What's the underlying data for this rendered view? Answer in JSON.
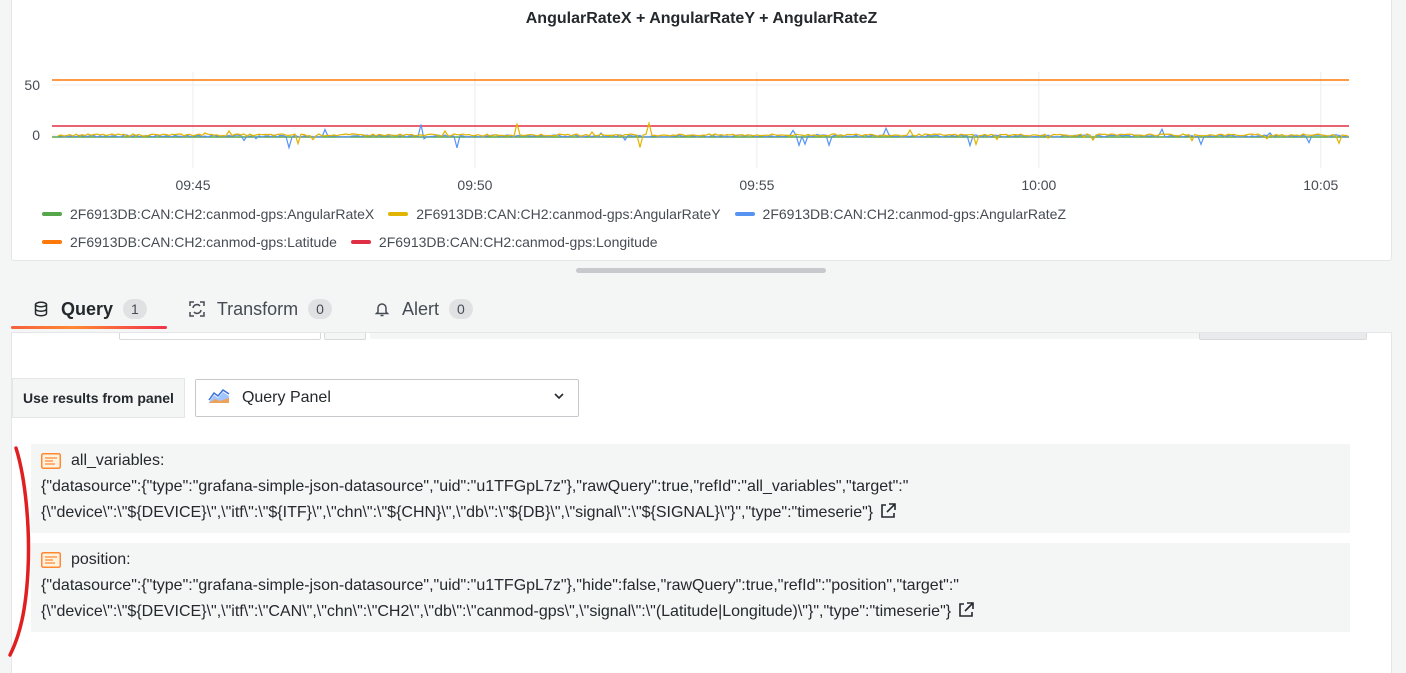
{
  "panel": {
    "title": "AngularRateX + AngularRateY + AngularRateZ"
  },
  "chart_data": {
    "type": "line",
    "title": "AngularRateX + AngularRateY + AngularRateZ",
    "y_ticks": [
      "50",
      "0"
    ],
    "y_tick_values": [
      50,
      0
    ],
    "x_ticks": [
      "09:45",
      "09:50",
      "09:55",
      "10:00",
      "10:05"
    ],
    "x_range": [
      "09:42:30",
      "10:05:30"
    ],
    "grid": true,
    "legend_position": "bottom",
    "series": [
      {
        "name": "2F6913DB:CAN:CH2:canmod-gps:AngularRateX",
        "color": "#56a64b",
        "approx_value": -2
      },
      {
        "name": "2F6913DB:CAN:CH2:canmod-gps:AngularRateY",
        "color": "#e0b400",
        "approx_value": 0,
        "noisy": true
      },
      {
        "name": "2F6913DB:CAN:CH2:canmod-gps:AngularRateZ",
        "color": "#5794f2",
        "approx_value": -1,
        "noisy": true
      },
      {
        "name": "2F6913DB:CAN:CH2:canmod-gps:Latitude",
        "color": "#ff780a",
        "approx_value": 55
      },
      {
        "name": "2F6913DB:CAN:CH2:canmod-gps:Longitude",
        "color": "#e02f44",
        "approx_value": 9
      }
    ]
  },
  "tabs": [
    {
      "label": "Query",
      "count": "1",
      "active": true,
      "icon": "database-icon"
    },
    {
      "label": "Transform",
      "count": "0",
      "active": false,
      "icon": "transform-icon"
    },
    {
      "label": "Alert",
      "count": "0",
      "active": false,
      "icon": "bell-icon"
    }
  ],
  "use_results": {
    "label": "Use results from panel",
    "selected": "Query Panel"
  },
  "queries": [
    {
      "name": "all_variables:",
      "line1": "{\"datasource\":{\"type\":\"grafana-simple-json-datasource\",\"uid\":\"u1TFGpL7z\"},\"rawQuery\":true,\"refId\":\"all_variables\",\"target\":\"",
      "line2": "{\\\"device\\\":\\\"${DEVICE}\\\",\\\"itf\\\":\\\"${ITF}\\\",\\\"chn\\\":\\\"${CHN}\\\",\\\"db\\\":\\\"${DB}\\\",\\\"signal\\\":\\\"${SIGNAL}\\\"}\",\"type\":\"timeserie\"}"
    },
    {
      "name": "position:",
      "line1": "{\"datasource\":{\"type\":\"grafana-simple-json-datasource\",\"uid\":\"u1TFGpL7z\"},\"hide\":false,\"rawQuery\":true,\"refId\":\"position\",\"target\":\"",
      "line2": "{\\\"device\\\":\\\"${DEVICE}\\\",\\\"itf\\\":\\\"CAN\\\",\\\"chn\\\":\\\"CH2\\\",\\\"db\\\":\\\"canmod-gps\\\",\\\"signal\\\":\\\"(Latitude|Longitude)\\\"}\",\"type\":\"timeserie\"}"
    }
  ]
}
